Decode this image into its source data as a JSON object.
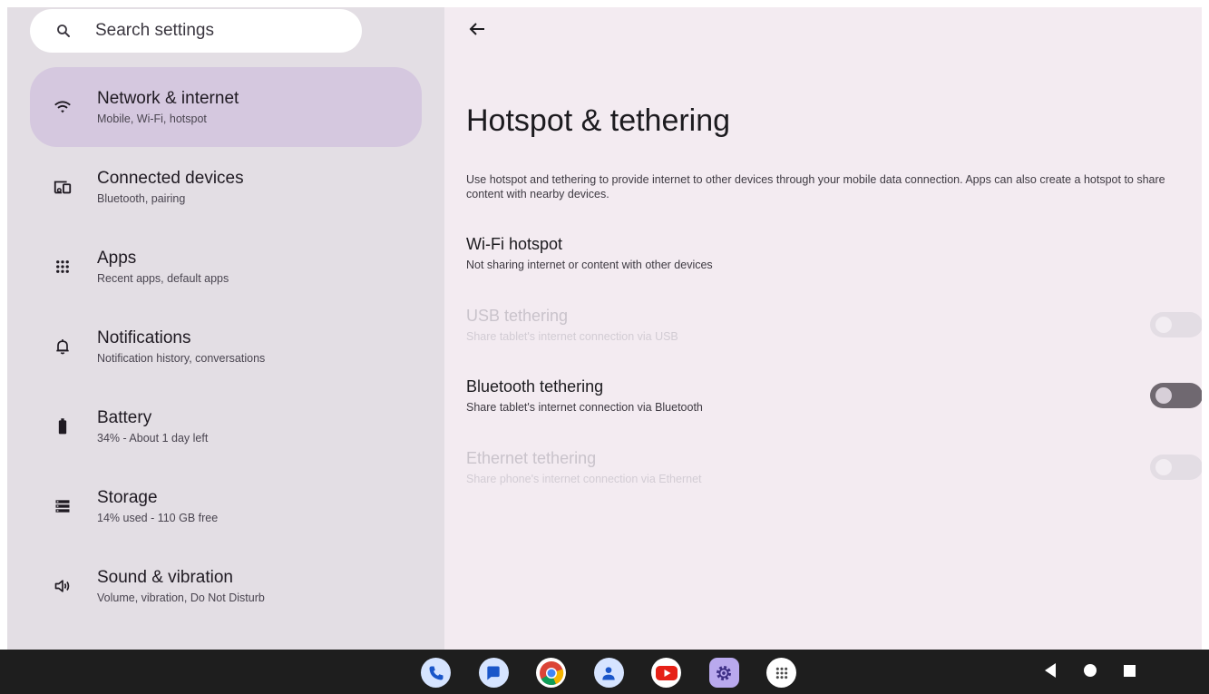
{
  "colors": {
    "left_bg": "#e3dee4",
    "right_bg": "#f3ebf1",
    "active_item": "#d5c8df",
    "taskbar": "#1e1e1e"
  },
  "search": {
    "placeholder": "Search settings",
    "icon": "search-icon"
  },
  "sidebar": {
    "items": [
      {
        "title": "Network & internet",
        "subtitle": "Mobile, Wi-Fi, hotspot",
        "icon": "wifi-icon",
        "active": true
      },
      {
        "title": "Connected devices",
        "subtitle": "Bluetooth, pairing",
        "icon": "connected-devices-icon"
      },
      {
        "title": "Apps",
        "subtitle": "Recent apps, default apps",
        "icon": "apps-grid-icon"
      },
      {
        "title": "Notifications",
        "subtitle": "Notification history, conversations",
        "icon": "bell-icon"
      },
      {
        "title": "Battery",
        "subtitle": "34% - About 1 day left",
        "icon": "battery-icon"
      },
      {
        "title": "Storage",
        "subtitle": "14% used - 110 GB free",
        "icon": "storage-icon"
      },
      {
        "title": "Sound & vibration",
        "subtitle": "Volume, vibration, Do Not Disturb",
        "icon": "volume-icon"
      }
    ]
  },
  "main": {
    "back_icon": "back-arrow-icon",
    "title": "Hotspot & tethering",
    "description": "Use hotspot and tethering to provide internet to other devices through your mobile data connection. Apps can also create a hotspot to share content with nearby devices.",
    "rows": [
      {
        "title": "Wi-Fi hotspot",
        "subtitle": "Not sharing internet or content with other devices",
        "enabled": true,
        "toggle": null
      },
      {
        "title": "USB tethering",
        "subtitle": "Share tablet's internet connection via USB",
        "enabled": false,
        "toggle": "off"
      },
      {
        "title": "Bluetooth tethering",
        "subtitle": "Share tablet's internet connection via Bluetooth",
        "enabled": true,
        "toggle": "off"
      },
      {
        "title": "Ethernet tethering",
        "subtitle": "Share phone's internet connection via Ethernet",
        "enabled": false,
        "toggle": "off"
      }
    ]
  },
  "taskbar": {
    "apps": [
      "phone-icon",
      "messages-icon",
      "chrome-icon",
      "contacts-icon",
      "youtube-icon",
      "settings-icon",
      "app-drawer-icon"
    ],
    "nav": [
      "back-triangle-icon",
      "home-circle-icon",
      "recents-square-icon"
    ]
  }
}
